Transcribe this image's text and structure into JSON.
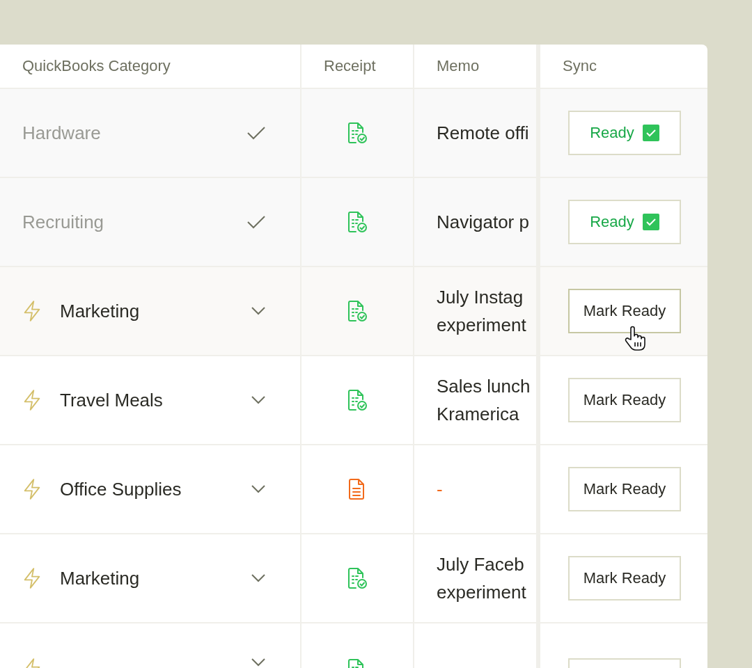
{
  "table": {
    "columns": [
      "QuickBooks Category",
      "Receipt",
      "Memo",
      "Sync"
    ],
    "rows": [
      {
        "category": "Hardware",
        "ready": true,
        "hovered": false,
        "receipt": {
          "kind": "matched"
        },
        "memo": [
          "Remote offi"
        ],
        "sync": "Ready"
      },
      {
        "category": "Recruiting",
        "ready": true,
        "hovered": false,
        "receipt": {
          "kind": "matched"
        },
        "memo": [
          "Navigator p"
        ],
        "sync": "Ready"
      },
      {
        "category": "Marketing",
        "ready": false,
        "hovered": true,
        "receipt": {
          "kind": "matched"
        },
        "memo": [
          "July Instag",
          "experiment"
        ],
        "sync": "Mark Ready"
      },
      {
        "category": "Travel Meals",
        "ready": false,
        "hovered": false,
        "receipt": {
          "kind": "matched"
        },
        "memo": [
          "Sales lunch",
          "Kramerica"
        ],
        "sync": "Mark Ready"
      },
      {
        "category": "Office Supplies",
        "ready": false,
        "hovered": false,
        "receipt": {
          "kind": "missing"
        },
        "memo": [
          "-"
        ],
        "sync": "Mark Ready"
      },
      {
        "category": "Marketing",
        "ready": false,
        "hovered": false,
        "receipt": {
          "kind": "matched"
        },
        "memo": [
          "July Faceb",
          "experiment"
        ],
        "sync": "Mark Ready"
      },
      {
        "ready": false,
        "hovered": false,
        "receipt": {
          "kind": "matched"
        }
      }
    ]
  }
}
